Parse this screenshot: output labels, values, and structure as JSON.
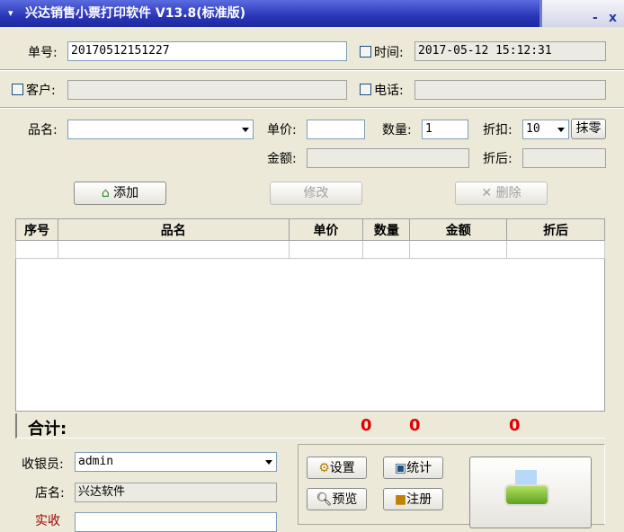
{
  "window": {
    "title": "兴达销售小票打印软件 V13.8(标准版)",
    "minimize": "-",
    "close": "x"
  },
  "order": {
    "no_label": "单号:",
    "no_value": "20170512151227",
    "time_label": "时间:",
    "time_value": "2017-05-12 15:12:31"
  },
  "customer": {
    "customer_label": "客户:",
    "customer_value": "",
    "phone_label": "电话:",
    "phone_value": ""
  },
  "item": {
    "name_label": "品名:",
    "name_value": "",
    "price_label": "单价:",
    "price_value": "",
    "qty_label": "数量:",
    "qty_value": "1",
    "discount_label": "折扣:",
    "discount_value": "10",
    "round_button": "抹零",
    "amount_label": "金额:",
    "amount_value": "",
    "after_label": "折后:",
    "after_value": ""
  },
  "actions": {
    "add": "添加",
    "edit": "修改",
    "delete": "删除"
  },
  "table": {
    "columns": [
      "序号",
      "品名",
      "单价",
      "数量",
      "金额",
      "折后"
    ],
    "rows": []
  },
  "totals": {
    "label": "合计:",
    "qty": "0",
    "amount": "0",
    "after": "0"
  },
  "bottom": {
    "cashier_label": "收银员:",
    "cashier_value": "admin",
    "shop_label": "店名:",
    "shop_value": "兴达软件",
    "received_label": "实收"
  },
  "tools": {
    "settings": "设置",
    "stats": "统计",
    "preview": "预览",
    "register": "注册"
  }
}
